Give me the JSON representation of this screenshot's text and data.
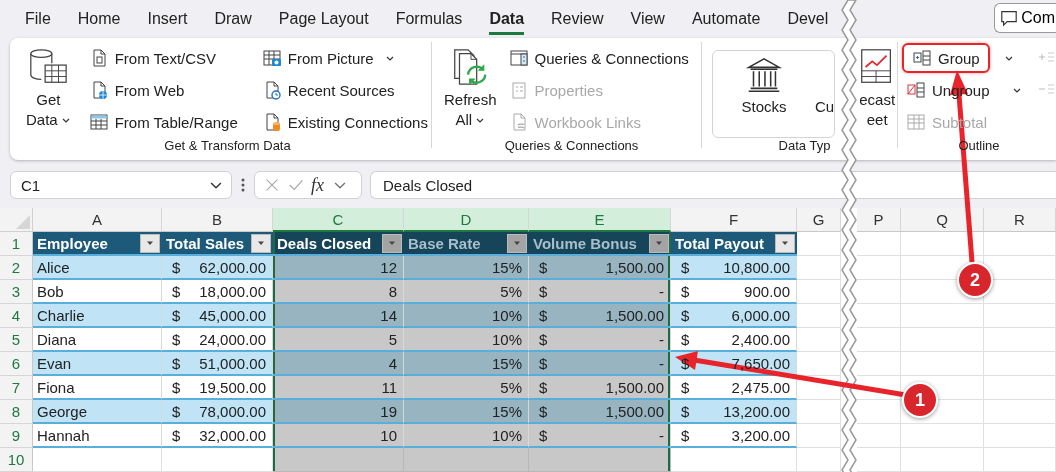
{
  "tabs": [
    {
      "label": "File",
      "selected": false
    },
    {
      "label": "Home",
      "selected": false
    },
    {
      "label": "Insert",
      "selected": false
    },
    {
      "label": "Draw",
      "selected": false
    },
    {
      "label": "Page Layout",
      "selected": false
    },
    {
      "label": "Formulas",
      "selected": false
    },
    {
      "label": "Data",
      "selected": true
    },
    {
      "label": "Review",
      "selected": false
    },
    {
      "label": "View",
      "selected": false
    },
    {
      "label": "Automate",
      "selected": false
    },
    {
      "label": "Devel",
      "selected": false
    }
  ],
  "comments_button": {
    "label": "Com"
  },
  "ribbon_groups": [
    {
      "label": "Get & Transform Data",
      "items": [
        {
          "kind": "large",
          "lines": [
            "Get",
            "Data"
          ],
          "dropdown": true
        },
        {
          "kind": "stack",
          "entries": [
            {
              "label": "From Text/CSV",
              "dropdown": false,
              "disabled": false,
              "highlighted": false
            },
            {
              "label": "From Web",
              "dropdown": false,
              "disabled": false,
              "highlighted": false
            },
            {
              "label": "From Table/Range",
              "dropdown": false,
              "disabled": false,
              "highlighted": false
            }
          ]
        },
        {
          "kind": "stack",
          "entries": [
            {
              "label": "From Picture",
              "dropdown": true,
              "disabled": false,
              "highlighted": false
            },
            {
              "label": "Recent Sources",
              "dropdown": false,
              "disabled": false,
              "highlighted": false
            },
            {
              "label": "Existing Connections",
              "dropdown": false,
              "disabled": false,
              "highlighted": false
            }
          ]
        }
      ]
    },
    {
      "label": "Queries & Connections",
      "items": [
        {
          "kind": "large",
          "lines": [
            "Refresh",
            "All"
          ],
          "dropdown": true
        },
        {
          "kind": "stack",
          "entries": [
            {
              "label": "Queries & Connections",
              "dropdown": false,
              "disabled": false,
              "highlighted": false
            },
            {
              "label": "Properties",
              "dropdown": false,
              "disabled": true,
              "highlighted": false
            },
            {
              "label": "Workbook Links",
              "dropdown": false,
              "disabled": true,
              "highlighted": false
            }
          ]
        }
      ]
    },
    {
      "label": "Data Typ",
      "items": [
        {
          "kind": "gallery",
          "labels": [
            "Stocks",
            "Cu"
          ]
        },
        {
          "kind": "large",
          "lines": [
            "ecast",
            "eet"
          ],
          "dropdown": false
        }
      ]
    },
    {
      "label": "Outline",
      "items": [
        {
          "kind": "stack",
          "entries": [
            {
              "label": "Group",
              "dropdown": true,
              "disabled": false,
              "highlighted": true
            },
            {
              "label": "Ungroup",
              "dropdown": true,
              "disabled": false,
              "highlighted": false
            },
            {
              "label": "Subtotal",
              "dropdown": false,
              "disabled": true,
              "highlighted": false
            }
          ]
        },
        {
          "kind": "tools"
        }
      ]
    }
  ],
  "formula_bar": {
    "name_box": "C1",
    "function_label": "fx",
    "formula": "Deals Closed"
  },
  "columns": [
    {
      "kind": "column",
      "letter": "A",
      "selected": false
    },
    {
      "kind": "column",
      "letter": "B",
      "selected": false
    },
    {
      "kind": "column",
      "letter": "C",
      "selected": true
    },
    {
      "kind": "column",
      "letter": "D",
      "selected": true
    },
    {
      "kind": "column",
      "letter": "E",
      "selected": true
    },
    {
      "kind": "column",
      "letter": "F",
      "selected": false
    },
    {
      "kind": "column",
      "letter": "G",
      "selected": false
    },
    {
      "kind": "break"
    },
    {
      "kind": "column",
      "letter": "P",
      "selected": false
    },
    {
      "kind": "column",
      "letter": "Q",
      "selected": false
    },
    {
      "kind": "column",
      "letter": "R",
      "selected": false
    }
  ],
  "row_headers": [
    {
      "label": "1",
      "selected": true
    },
    {
      "label": "2",
      "selected": true
    },
    {
      "label": "3",
      "selected": true
    },
    {
      "label": "4",
      "selected": true
    },
    {
      "label": "5",
      "selected": true
    },
    {
      "label": "6",
      "selected": true
    },
    {
      "label": "7",
      "selected": true
    },
    {
      "label": "8",
      "selected": true
    },
    {
      "label": "9",
      "selected": true
    },
    {
      "label": "10",
      "selected": true
    }
  ],
  "table": {
    "headers": [
      {
        "label": "Employee",
        "active": false
      },
      {
        "label": "Total Sales",
        "active": false
      },
      {
        "label": "Deals Closed",
        "active": true
      },
      {
        "label": "Base Rate",
        "active": false
      },
      {
        "label": "Volume Bonus",
        "active": false
      },
      {
        "label": "Total Payout",
        "active": false
      }
    ],
    "rows": [
      [
        {
          "text": "Alice"
        },
        {
          "currency": "$",
          "text": "62,000.00"
        },
        {
          "text": "12"
        },
        {
          "text": "15%"
        },
        {
          "currency": "$",
          "text": "1,500.00"
        },
        {
          "currency": "$",
          "text": "10,800.00"
        }
      ],
      [
        {
          "text": "Bob"
        },
        {
          "currency": "$",
          "text": "18,000.00"
        },
        {
          "text": "8"
        },
        {
          "text": "5%"
        },
        {
          "currency": "$",
          "text": "-"
        },
        {
          "currency": "$",
          "text": "900.00"
        }
      ],
      [
        {
          "text": "Charlie"
        },
        {
          "currency": "$",
          "text": "45,000.00"
        },
        {
          "text": "14"
        },
        {
          "text": "10%"
        },
        {
          "currency": "$",
          "text": "1,500.00"
        },
        {
          "currency": "$",
          "text": "6,000.00"
        }
      ],
      [
        {
          "text": "Diana"
        },
        {
          "currency": "$",
          "text": "24,000.00"
        },
        {
          "text": "5"
        },
        {
          "text": "10%"
        },
        {
          "currency": "$",
          "text": "-"
        },
        {
          "currency": "$",
          "text": "2,400.00"
        }
      ],
      [
        {
          "text": "Evan"
        },
        {
          "currency": "$",
          "text": "51,000.00"
        },
        {
          "text": "4"
        },
        {
          "text": "15%"
        },
        {
          "currency": "$",
          "text": "-"
        },
        {
          "currency": "$",
          "text": "7,650.00"
        }
      ],
      [
        {
          "text": "Fiona"
        },
        {
          "currency": "$",
          "text": "19,500.00"
        },
        {
          "text": "11"
        },
        {
          "text": "5%"
        },
        {
          "currency": "$",
          "text": "1,500.00"
        },
        {
          "currency": "$",
          "text": "2,475.00"
        }
      ],
      [
        {
          "text": "George"
        },
        {
          "currency": "$",
          "text": "78,000.00"
        },
        {
          "text": "19"
        },
        {
          "text": "15%"
        },
        {
          "currency": "$",
          "text": "1,500.00"
        },
        {
          "currency": "$",
          "text": "13,200.00"
        }
      ],
      [
        {
          "text": "Hannah"
        },
        {
          "currency": "$",
          "text": "32,000.00"
        },
        {
          "text": "10"
        },
        {
          "text": "10%"
        },
        {
          "currency": "$",
          "text": "-"
        },
        {
          "currency": "$",
          "text": "3,200.00"
        }
      ]
    ]
  },
  "callouts": [
    {
      "label": "1"
    },
    {
      "label": "2"
    }
  ]
}
